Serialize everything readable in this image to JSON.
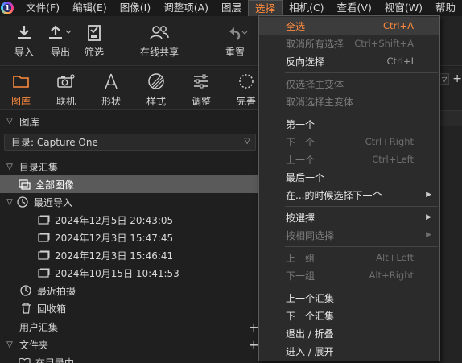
{
  "menubar": {
    "logo_letter": "1",
    "items": [
      "文件(F)",
      "编辑(E)",
      "图像(I)",
      "调整项(A)",
      "图层",
      "选择",
      "相机(C)",
      "查看(V)",
      "视窗(W)",
      "帮助"
    ]
  },
  "toolbar": {
    "import": "导入",
    "export": "导出",
    "cull": "筛选",
    "live": "在线共享",
    "reset": "重置"
  },
  "tooltabs": [
    "图库",
    "联机",
    "形状",
    "样式",
    "调整",
    "完善"
  ],
  "library": {
    "header": "图库",
    "catalog_select": "目录: Capture One",
    "catalog_collections": "目录汇集",
    "all_images": "全部图像",
    "recent_imports": "最近导入",
    "imports": [
      "2024年12月5日 20:43:05",
      "2024年12月3日 15:47:45",
      "2024年12月3日 15:46:41",
      "2024年10月15日 10:41:53"
    ],
    "recent_captures": "最近拍摄",
    "trash": "回收箱",
    "user_collections": "用户汇集",
    "folders": "文件夹",
    "in_catalog": "在目录中",
    "plus": "+"
  },
  "select_menu": {
    "items": [
      {
        "label": "全选",
        "shortcut": "Ctrl+A",
        "state": "highlighted"
      },
      {
        "label": "取消所有选择",
        "shortcut": "Ctrl+Shift+A",
        "state": "disabled"
      },
      {
        "label": "反向选择",
        "shortcut": "Ctrl+I",
        "state": "enabled"
      },
      {
        "label": "仅选择主变体",
        "shortcut": "",
        "state": "disabled"
      },
      {
        "label": "取消选择主变体",
        "shortcut": "",
        "state": "disabled"
      },
      {
        "label": "第一个",
        "shortcut": "",
        "state": "enabled"
      },
      {
        "label": "下一个",
        "shortcut": "Ctrl+Right",
        "state": "disabled"
      },
      {
        "label": "上一个",
        "shortcut": "Ctrl+Left",
        "state": "disabled"
      },
      {
        "label": "最后一个",
        "shortcut": "",
        "state": "enabled"
      },
      {
        "label": "在...的时候选择下一个",
        "shortcut": "",
        "state": "enabled",
        "submenu": true
      },
      {
        "label": "按選擇",
        "shortcut": "",
        "state": "enabled",
        "submenu": true
      },
      {
        "label": "按相同选择",
        "shortcut": "",
        "state": "disabled",
        "submenu": true
      },
      {
        "label": "上一组",
        "shortcut": "Alt+Left",
        "state": "disabled"
      },
      {
        "label": "下一组",
        "shortcut": "Alt+Right",
        "state": "disabled"
      },
      {
        "label": "上一个汇集",
        "shortcut": "",
        "state": "enabled"
      },
      {
        "label": "下一个汇集",
        "shortcut": "",
        "state": "enabled"
      },
      {
        "label": "退出 / 折叠",
        "shortcut": "",
        "state": "enabled"
      },
      {
        "label": "进入 / 展开",
        "shortcut": "",
        "state": "enabled"
      }
    ]
  },
  "colors": {
    "accent": "#ff8a3d",
    "background": "#1e1e1e",
    "selected_row": "#5a5a5a"
  }
}
